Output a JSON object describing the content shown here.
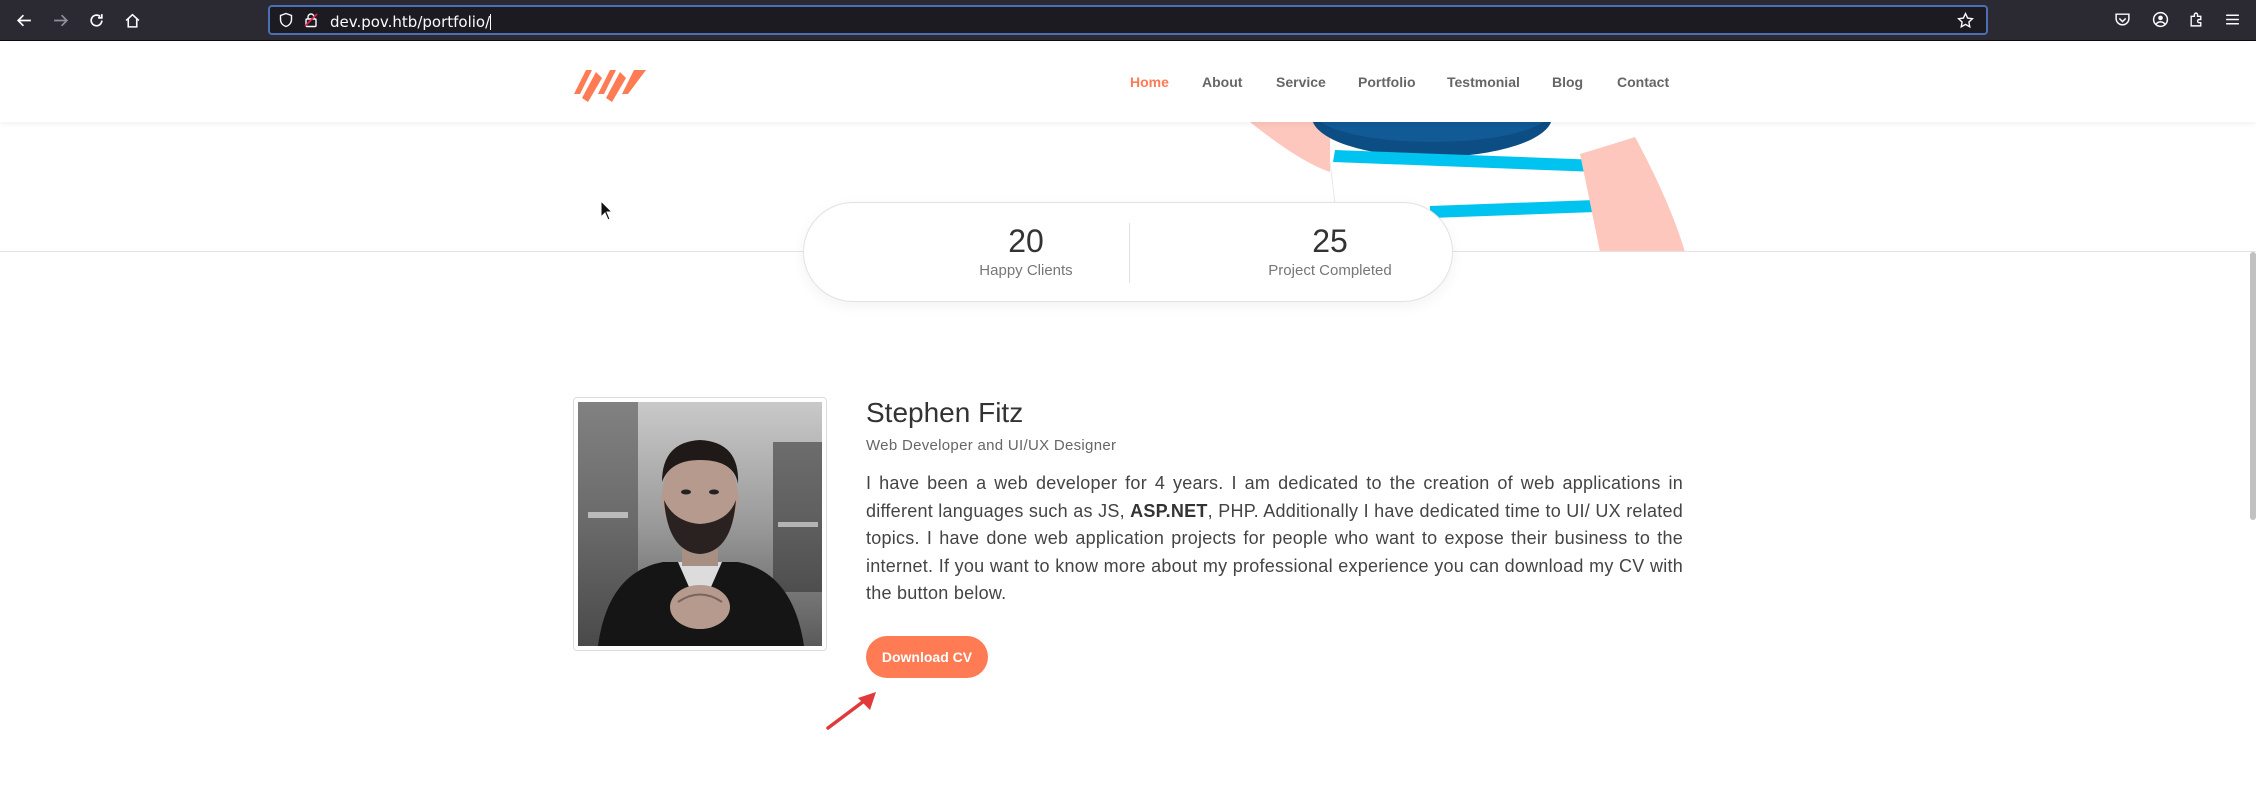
{
  "browser": {
    "url": "dev.pov.htb/portfolio/",
    "icons": [
      "back-icon",
      "forward-icon",
      "reload-icon",
      "home-icon",
      "shield-icon",
      "lock-icon",
      "star-icon",
      "pocket-icon",
      "account-icon",
      "extensions-icon",
      "menu-icon"
    ]
  },
  "nav": {
    "items": [
      {
        "label": "Home",
        "active": true
      },
      {
        "label": "About"
      },
      {
        "label": "Service"
      },
      {
        "label": "Portfolio"
      },
      {
        "label": "Testmonial"
      },
      {
        "label": "Blog"
      },
      {
        "label": "Contact"
      }
    ],
    "accent": "#ff7b54"
  },
  "stats": [
    {
      "number": "20",
      "label": "Happy Clients"
    },
    {
      "number": "25",
      "label": "Project Completed"
    }
  ],
  "profile": {
    "name": "Stephen Fitz",
    "role": "Web Developer and UI/UX Designer",
    "bio_before": "I have been a web developer for 4 years. I am dedicated to the creation of web applications in different languages such as JS, ",
    "bio_bold": "ASP.NET",
    "bio_after": ", PHP. Additionally I have dedicated time to UI/ UX related topics. I have done web application projects for people who want to expose their business to the internet. If you want to know more about my professional experience you can download my CV with the button below.",
    "cv_button": "Download CV"
  }
}
